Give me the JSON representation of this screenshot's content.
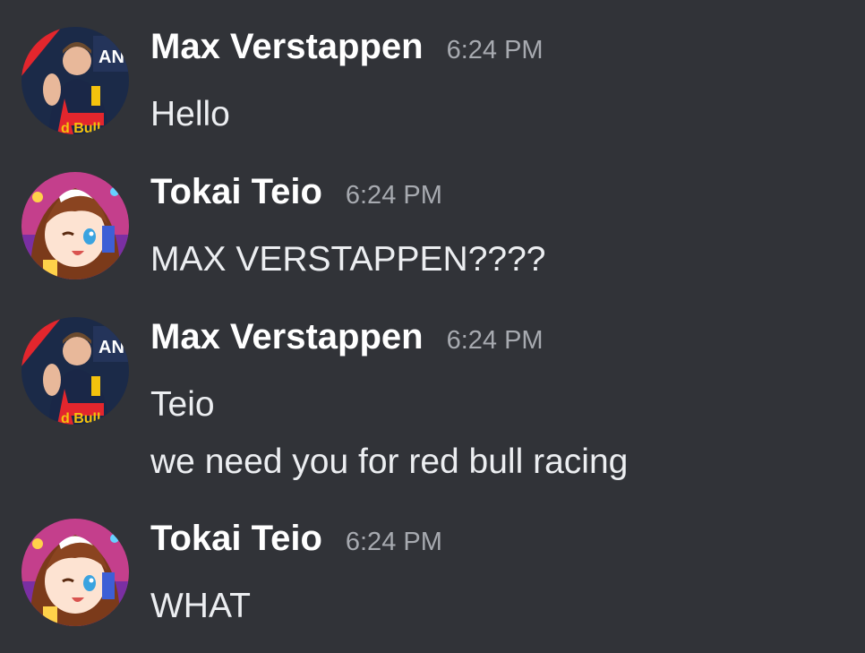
{
  "messages": [
    {
      "author": "Max Verstappen",
      "time": "6:24 PM",
      "avatar_icon": "race-driver-avatar",
      "lines": [
        "Hello"
      ]
    },
    {
      "author": "Tokai Teio",
      "time": "6:24 PM",
      "avatar_icon": "anime-girl-avatar",
      "lines": [
        "MAX VERSTAPPEN????"
      ]
    },
    {
      "author": "Max Verstappen",
      "time": "6:24 PM",
      "avatar_icon": "race-driver-avatar",
      "lines": [
        "Teio",
        "we need you for red bull racing"
      ]
    },
    {
      "author": "Tokai Teio",
      "time": "6:24 PM",
      "avatar_icon": "anime-girl-avatar",
      "lines": [
        "WHAT"
      ]
    }
  ],
  "colors": {
    "background": "#313338",
    "username": "#ffffff",
    "timestamp": "#a7aab0",
    "text": "#eceef1"
  }
}
